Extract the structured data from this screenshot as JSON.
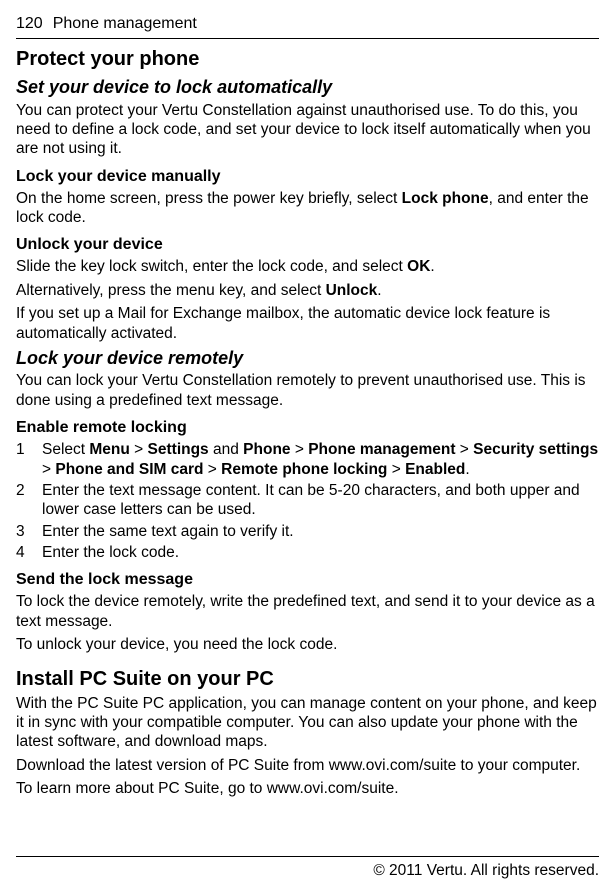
{
  "header": {
    "page_number": "120",
    "section": "Phone management"
  },
  "sections": {
    "protect_title": "Protect your phone",
    "auto_lock": {
      "title": "Set your device to lock automatically",
      "intro": "You can protect your Vertu Constellation against unauthorised use. To do this, you need to define a lock code, and set your device to lock itself automatically when you are not using it."
    },
    "lock_manually": {
      "title": "Lock your device manually",
      "p1a": "On the home screen, press the power key briefly, select ",
      "p1b": "Lock phone",
      "p1c": ", and enter the lock code."
    },
    "unlock": {
      "title": "Unlock your device",
      "p1a": "Slide the key lock switch, enter the lock code, and select ",
      "p1b": "OK",
      "p1c": ".",
      "p2a": "Alternatively, press the menu key, and select ",
      "p2b": "Unlock",
      "p2c": ".",
      "p3": "If you set up a Mail for Exchange mailbox, the automatic device lock feature is automatically activated."
    },
    "remote": {
      "title": "Lock your device remotely",
      "intro": "You can lock your Vertu Constellation remotely to prevent unauthorised use. This is done using a predefined text message."
    },
    "enable_remote": {
      "title": "Enable remote locking",
      "step1": {
        "num": "1",
        "a": "Select ",
        "menu": "Menu",
        "gt1": " > ",
        "settings": "Settings",
        "and": " and ",
        "phone": "Phone",
        "gt2": " > ",
        "phone_mgmt": "Phone management",
        "gt3": " > ",
        "sec": "Security settings",
        "gt4": " > ",
        "sim": "Phone and SIM card",
        "gt5": " > ",
        "rpl": "Remote phone locking",
        "gt6": " > ",
        "enabled": "Enabled",
        "dot": "."
      },
      "step2": {
        "num": "2",
        "text": "Enter the text message content. It can be 5-20 characters, and both upper and lower case letters can be used."
      },
      "step3": {
        "num": "3",
        "text": "Enter the same text again to verify it."
      },
      "step4": {
        "num": "4",
        "text": "Enter the lock code."
      }
    },
    "send_lock": {
      "title": "Send the lock message",
      "p1": "To lock the device remotely, write the predefined text, and send it to your device as a text message.",
      "p2": "To unlock your device, you need the lock code."
    },
    "pc_suite": {
      "title": "Install PC Suite on your PC",
      "p1": "With the PC Suite PC application, you can manage content on your phone, and keep it in sync with your compatible computer. You can also update your phone with the latest software, and download maps.",
      "p2": "Download the latest version of PC Suite from www.ovi.com/suite to your computer.",
      "p3": "To learn more about PC Suite, go to www.ovi.com/suite."
    }
  },
  "footer": "© 2011 Vertu. All rights reserved."
}
